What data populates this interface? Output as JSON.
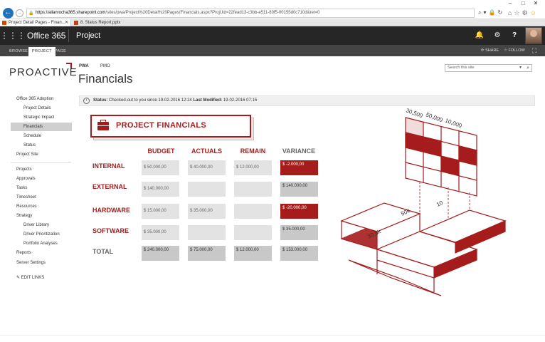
{
  "browser": {
    "url_host": "https://allanrocha365.sharepoint.com",
    "url_path": "/sites/pwa/Project%20Detail%20Pages/Financials.aspx?ProjUid=22fead13-c3bb-e511-80f5-00155d0c710d&ret=0",
    "tabs": [
      {
        "label": "Project Detail Pages - Finan...",
        "icon_color": "#d04a02"
      },
      {
        "label": "8. Status Report.pptx",
        "icon_color": "#c43e1c"
      }
    ]
  },
  "suitebar": {
    "app_name": "Office 365",
    "site_name": "Project"
  },
  "ribbon": {
    "tabs": [
      "BROWSE",
      "PROJECT",
      "PAGE"
    ],
    "active_tab": "PROJECT",
    "share": "SHARE",
    "follow": "FOLLOW"
  },
  "header": {
    "logo": "PROACTIVE",
    "top_links": [
      "PWA",
      "PMO"
    ],
    "title": "Financials",
    "search_placeholder": "Search this site"
  },
  "nav": {
    "items": [
      {
        "label": "Office 365 Adoption",
        "level": 0
      },
      {
        "label": "Project Details",
        "level": 1
      },
      {
        "label": "Strategic Impact",
        "level": 1
      },
      {
        "label": "Financials",
        "level": 1,
        "selected": true
      },
      {
        "label": "Schedule",
        "level": 1
      },
      {
        "label": "Status",
        "level": 1
      },
      {
        "label": "Project Site",
        "level": 0
      },
      {
        "label": "Projects",
        "level": 0
      },
      {
        "label": "Approvals",
        "level": 0
      },
      {
        "label": "Tasks",
        "level": 0
      },
      {
        "label": "Timesheet",
        "level": 0
      },
      {
        "label": "Resources",
        "level": 0
      },
      {
        "label": "Strategy",
        "level": 0
      },
      {
        "label": "Driver Library",
        "level": 1
      },
      {
        "label": "Driver Prioritization",
        "level": 1
      },
      {
        "label": "Portfolio Analyses",
        "level": 1
      },
      {
        "label": "Reports",
        "level": 0
      },
      {
        "label": "Server Settings",
        "level": 0
      }
    ],
    "edit_links": "EDIT LINKS"
  },
  "status": {
    "label": "Status:",
    "text": "Checked-out to you since 19-02-2016 12:24",
    "modified_label": "Last Modified:",
    "modified_value": "19-02-2016 07:15"
  },
  "financials": {
    "banner": "PROJECT FINANCIALS",
    "columns": [
      "BUDGET",
      "ACTUALS",
      "REMAIN",
      "VARIANCE"
    ],
    "rows": [
      {
        "label": "INTERNAL",
        "budget": "$ 50.000,00",
        "actuals": "$ 40.000,00",
        "remain": "$ 12.000,00",
        "variance": "$ -2.000,00"
      },
      {
        "label": "EXTERNAL",
        "budget": "$ 140.000,00",
        "actuals": "",
        "remain": "",
        "variance": "$ 140.000,00"
      },
      {
        "label": "HARDWARE",
        "budget": "$ 15.000,00",
        "actuals": "$ 35.000,00",
        "remain": "",
        "variance": "$ -20.000,00"
      },
      {
        "label": "SOFTWARE",
        "budget": "$ 35.000,00",
        "actuals": "",
        "remain": "",
        "variance": "$ 35.000,00"
      },
      {
        "label": "TOTAL",
        "budget": "$ 240.000,00",
        "actuals": "$ 75.000,00",
        "remain": "$ 12.000,00",
        "variance": "$ 153.000,00"
      }
    ]
  },
  "illustration": {
    "labels": [
      "30,500",
      "50,000",
      "10,000",
      "50k",
      "10",
      "30,5k"
    ]
  },
  "colors": {
    "accent": "#a61c1c",
    "suitebar": "#262626",
    "ribbon": "#444444"
  }
}
